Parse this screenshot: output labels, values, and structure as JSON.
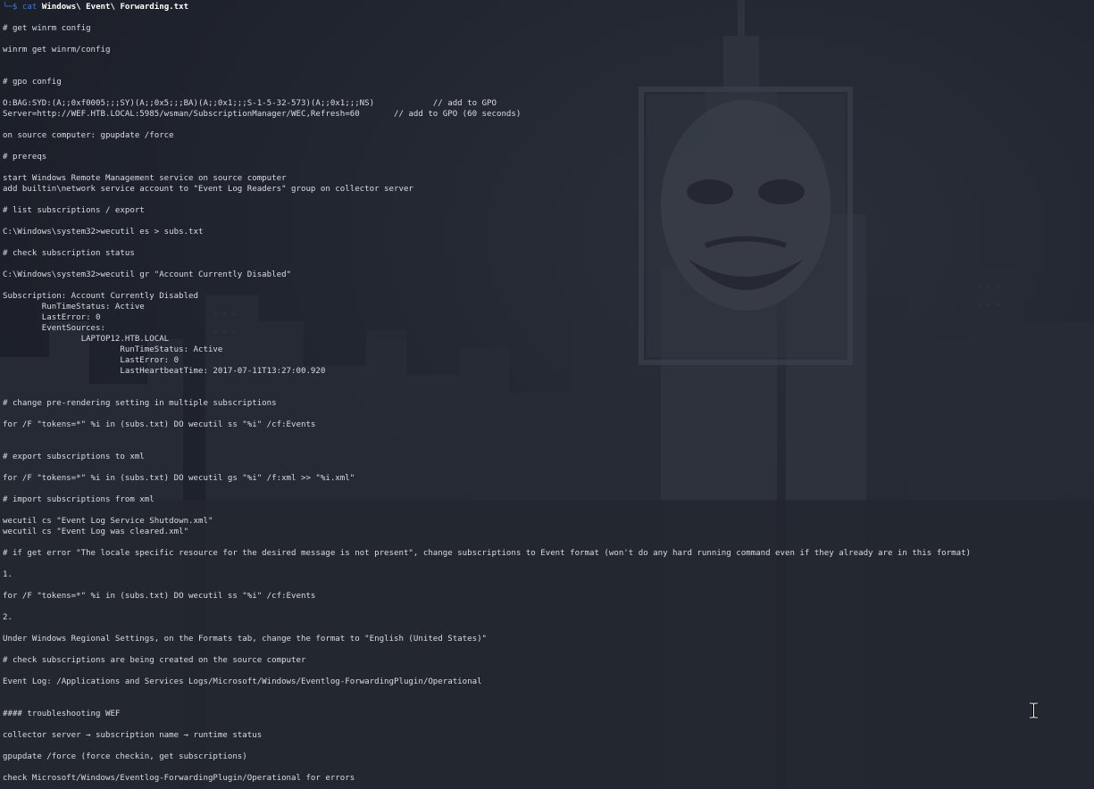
{
  "prompt": {
    "corner": "└─",
    "symbol": "$",
    "command": "cat",
    "argument": "Windows\\ Event\\ Forwarding.txt"
  },
  "file_lines": [
    "",
    "# get winrm config",
    "",
    "winrm get winrm/config",
    "",
    "",
    "# gpo config",
    "",
    "O:BAG:SYD:(A;;0xf0005;;;SY)(A;;0x5;;;BA)(A;;0x1;;;S-1-5-32-573)(A;;0x1;;;NS)            // add to GPO",
    "Server=http://WEF.HTB.LOCAL:5985/wsman/SubscriptionManager/WEC,Refresh=60       // add to GPO (60 seconds)",
    "",
    "on source computer: gpupdate /force",
    "",
    "# prereqs",
    "",
    "start Windows Remote Management service on source computer",
    "add builtin\\network service account to \"Event Log Readers\" group on collector server",
    "",
    "# list subscriptions / export",
    "",
    "C:\\Windows\\system32>wecutil es > subs.txt",
    "",
    "# check subscription status",
    "",
    "C:\\Windows\\system32>wecutil gr \"Account Currently Disabled\"",
    "",
    "Subscription: Account Currently Disabled",
    "        RunTimeStatus: Active",
    "        LastError: 0",
    "        EventSources:",
    "                LAPTOP12.HTB.LOCAL",
    "                        RunTimeStatus: Active",
    "                        LastError: 0",
    "                        LastHeartbeatTime: 2017-07-11T13:27:00.920",
    "",
    "",
    "# change pre-rendering setting in multiple subscriptions",
    "",
    "for /F \"tokens=*\" %i in (subs.txt) DO wecutil ss \"%i\" /cf:Events",
    "",
    "",
    "# export subscriptions to xml",
    "",
    "for /F \"tokens=*\" %i in (subs.txt) DO wecutil gs \"%i\" /f:xml >> \"%i.xml\"",
    "",
    "# import subscriptions from xml",
    "",
    "wecutil cs \"Event Log Service Shutdown.xml\"",
    "wecutil cs \"Event Log was cleared.xml\"",
    "",
    "# if get error \"The locale specific resource for the desired message is not present\", change subscriptions to Event format (won't do any hard running command even if they already are in this format)",
    "",
    "1.",
    "",
    "for /F \"tokens=*\" %i in (subs.txt) DO wecutil ss \"%i\" /cf:Events",
    "",
    "2.",
    "",
    "Under Windows Regional Settings, on the Formats tab, change the format to \"English (United States)\"",
    "",
    "# check subscriptions are being created on the source computer",
    "",
    "Event Log: /Applications and Services Logs/Microsoft/Windows/Eventlog-ForwardingPlugin/Operational",
    "",
    "",
    "#### troubleshooting WEF",
    "",
    "collector server → subscription name → runtime status",
    "",
    "gpupdate /force (force checkin, get subscriptions)",
    "",
    "check Microsoft/Windows/Eventlog-ForwardingPlugin/Operational for errors"
  ],
  "colors": {
    "background": "#1c2029",
    "text": "#d9dce2",
    "prompt_accent": "#3d7bd9",
    "prompt_argument": "#ffffff"
  },
  "icons": {
    "text_cursor": "i-beam-cursor-icon",
    "wallpaper": "city-skyline-mask-wallpaper"
  }
}
